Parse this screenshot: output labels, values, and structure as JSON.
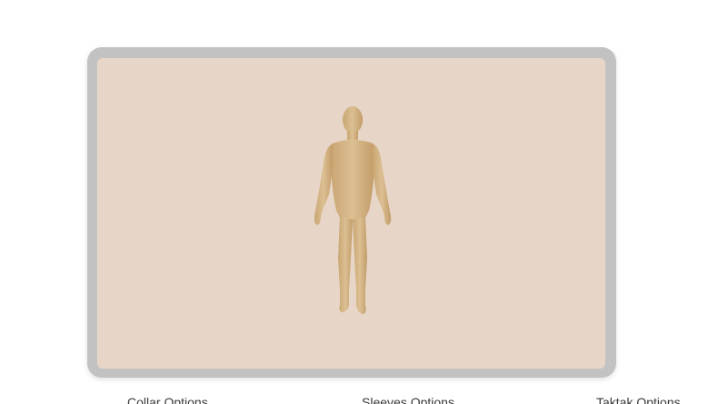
{
  "viewer": {
    "background_color": "#e7d6c7",
    "frame_color": "#c2c2c2",
    "model": {
      "label": "human-body-model",
      "skin_color": "#d8b88a"
    }
  },
  "options": {
    "tabs": [
      {
        "label": "Collar Options"
      },
      {
        "label": "Sleeves Options"
      },
      {
        "label": "Taktak Options"
      }
    ]
  }
}
